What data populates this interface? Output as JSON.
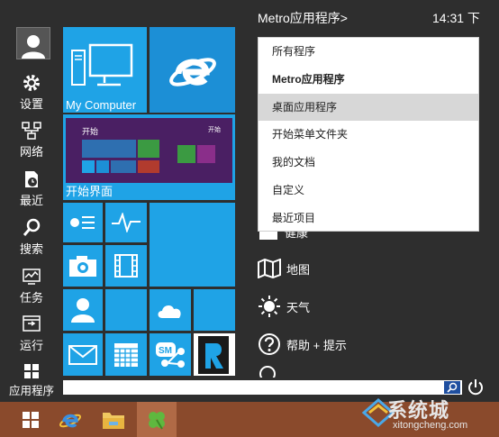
{
  "header": {
    "title": "Metro应用程序>",
    "clock": "14:31 下"
  },
  "rail": {
    "items": [
      {
        "label": "设置",
        "icon": "gear-icon"
      },
      {
        "label": "网络",
        "icon": "network-icon"
      },
      {
        "label": "最近",
        "icon": "recent-icon"
      },
      {
        "label": "搜索",
        "icon": "search-icon"
      },
      {
        "label": "任务",
        "icon": "task-icon"
      },
      {
        "label": "运行",
        "icon": "run-icon"
      },
      {
        "label": "应用程序",
        "icon": "apps-icon"
      }
    ]
  },
  "tiles": {
    "my_computer": "My Computer",
    "start_screen": "开始界面",
    "start_preview_title": "开始",
    "start_preview_small": "开始"
  },
  "dropdown": {
    "items": [
      {
        "label": "所有程序",
        "bold": false,
        "selected": false
      },
      {
        "label": "Metro应用程序",
        "bold": true,
        "selected": false
      },
      {
        "label": "桌面应用程序",
        "bold": false,
        "selected": true
      },
      {
        "label": "开始菜单文件夹",
        "bold": false,
        "selected": false
      },
      {
        "label": "我的文档",
        "bold": false,
        "selected": false
      },
      {
        "label": "自定义",
        "bold": false,
        "selected": false
      },
      {
        "label": "最近项目",
        "bold": false,
        "selected": false
      }
    ]
  },
  "apps": {
    "partial": "健康",
    "map": "地图",
    "weather": "天气",
    "help": "帮助 + 提示"
  },
  "watermark": {
    "text": "系统城",
    "url": "xitongcheng.com"
  },
  "colors": {
    "tile": "#1fa3e6",
    "menu_bg": "#2e2e2e",
    "taskbar": "#8a4a2c"
  }
}
